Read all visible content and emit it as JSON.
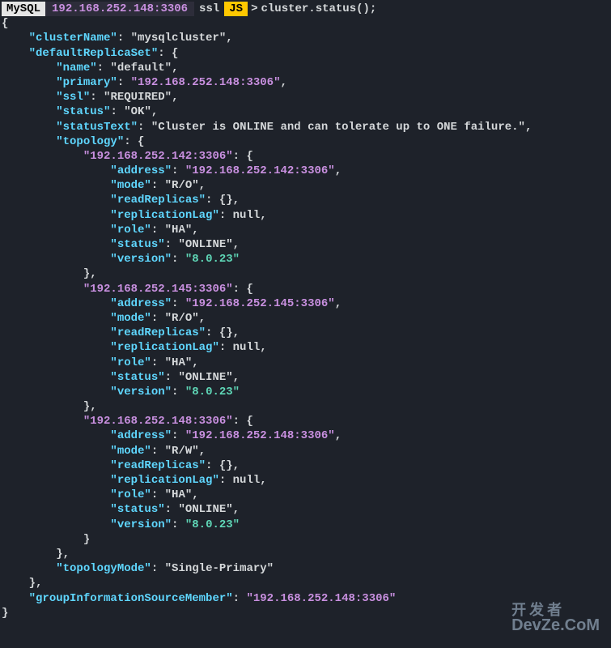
{
  "prompt": {
    "mysql": "MySQL",
    "host": "192.168.252.148:3306",
    "ssl": "ssl",
    "js": "JS",
    "arrow": ">",
    "command": "cluster.status();"
  },
  "json": {
    "clusterName_key": "\"clusterName\"",
    "clusterName_val": "\"mysqlcluster\"",
    "defaultReplicaSet_key": "\"defaultReplicaSet\"",
    "name_key": "\"name\"",
    "name_val": "\"default\"",
    "primary_key": "\"primary\"",
    "primary_val": "\"192.168.252.148:3306\"",
    "ssl_key": "\"ssl\"",
    "ssl_val": "\"REQUIRED\"",
    "status_key": "\"status\"",
    "status_val": "\"OK\"",
    "statusText_key": "\"statusText\"",
    "statusText_val": "\"Cluster is ONLINE and can tolerate up to ONE failure.\"",
    "topology_key": "\"topology\"",
    "node1_key": "\"192.168.252.142:3306\"",
    "node2_key": "\"192.168.252.145:3306\"",
    "node3_key": "\"192.168.252.148:3306\"",
    "address_key": "\"address\"",
    "node1_address": "\"192.168.252.142:3306\"",
    "node2_address": "\"192.168.252.145:3306\"",
    "node3_address": "\"192.168.252.148:3306\"",
    "mode_key": "\"mode\"",
    "mode_ro": "\"R/O\"",
    "mode_rw": "\"R/W\"",
    "readReplicas_key": "\"readReplicas\"",
    "replicationLag_key": "\"replicationLag\"",
    "null_val": "null",
    "role_key": "\"role\"",
    "role_val": "\"HA\"",
    "status_online": "\"ONLINE\"",
    "version_key": "\"version\"",
    "version_val": "\"8.0.23\"",
    "topologyMode_key": "\"topologyMode\"",
    "topologyMode_val": "\"Single-Primary\"",
    "groupInfo_key": "\"groupInformationSourceMember\"",
    "groupInfo_val": "\"192.168.252.148:3306\""
  },
  "watermark": {
    "line1": "开发者",
    "line2": "DevZe.CoM"
  }
}
